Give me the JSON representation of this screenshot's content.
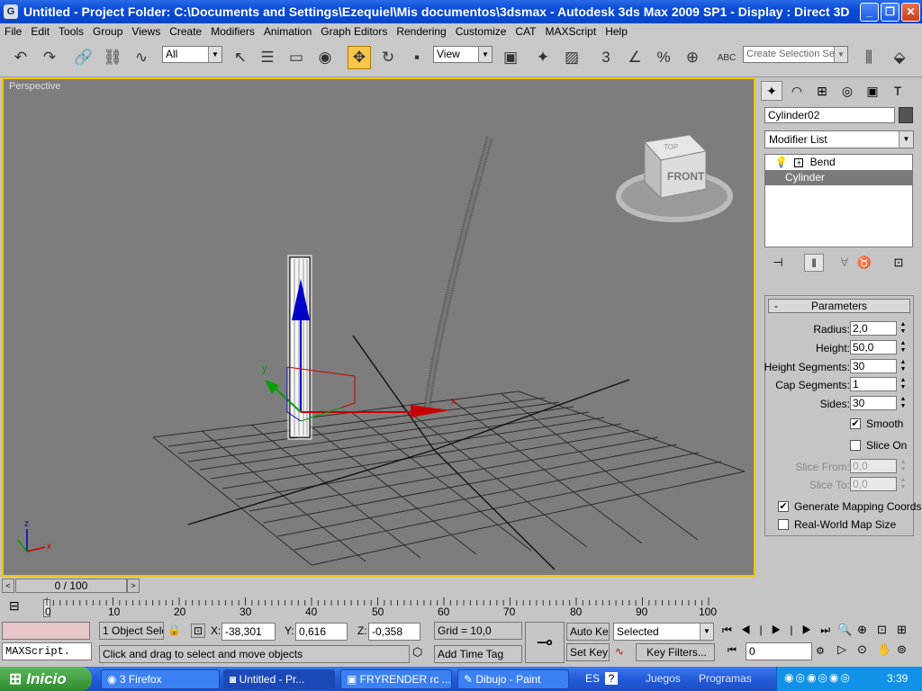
{
  "window": {
    "app_glyph": "G",
    "title": "Untitled    - Project Folder: C:\\Documents and Settings\\Ezequiel\\Mis documentos\\3dsmax    - Autodesk 3ds Max  2009 SP1    - Display : Direct 3D",
    "min": "_",
    "max": "❐",
    "close": "✕"
  },
  "menu": [
    "File",
    "Edit",
    "Tools",
    "Group",
    "Views",
    "Create",
    "Modifiers",
    "Animation",
    "Graph Editors",
    "Rendering",
    "Customize",
    "CAT",
    "MAXScript",
    "Help"
  ],
  "toolbar": {
    "filter_value": "All",
    "refcoord_value": "View",
    "named_selection_placeholder": "Create Selection Set",
    "icons": {
      "undo": "↶",
      "redo": "↷",
      "link": "🔗",
      "unlink": "⛓",
      "bind": "∿",
      "select": "↖",
      "select_by_name": "☰",
      "rect_select": "▭",
      "window_cross": "◉",
      "move": "✥",
      "rotate": "↻",
      "scale": "▪",
      "pivot": "▣",
      "manipulate": "✦",
      "keyboard": "▨",
      "snap3": "3",
      "angle_snap": "∠",
      "percent_snap": "%",
      "spinner_snap": "⊕",
      "edit_named": "ABC",
      "mirror": "⫼",
      "align": "⬙"
    }
  },
  "viewport": {
    "label": "Perspective",
    "viewcube_front": "FRONT",
    "viewcube_top": "TOP",
    "gizmo_x": "x",
    "gizmo_y": "y",
    "axis_x": "x",
    "axis_z": "z"
  },
  "command_panel": {
    "tab_icons": [
      "✦",
      "◠",
      "⊞",
      "◎",
      "▣",
      "T"
    ],
    "object_name": "Cylinder02",
    "modifier_list": "Modifier List",
    "stack": [
      {
        "label": "Bend",
        "prefix": "+",
        "selected": false
      },
      {
        "label": "Cylinder",
        "selected": true
      }
    ],
    "stack_tools": [
      "⊣",
      "‖",
      "∀",
      "♉",
      "⊡"
    ],
    "rollout_toggle": "-",
    "rollout_title": "Parameters",
    "params": [
      {
        "label": "Radius:",
        "value": "2,0",
        "disabled": false
      },
      {
        "label": "Height:",
        "value": "50,0",
        "disabled": false
      },
      {
        "label": "Height Segments:",
        "value": "30",
        "disabled": false
      },
      {
        "label": "Cap Segments:",
        "value": "1",
        "disabled": false
      },
      {
        "label": "Sides:",
        "value": "30",
        "disabled": false
      }
    ],
    "smooth": {
      "label": "Smooth",
      "checked": true
    },
    "slice_on": {
      "label": "Slice On",
      "checked": false
    },
    "slice_params": [
      {
        "label": "Slice From:",
        "value": "0,0",
        "disabled": true
      },
      {
        "label": "Slice To:",
        "value": "0,0",
        "disabled": true
      }
    ],
    "gen_mapping": {
      "label": "Generate Mapping Coords.",
      "checked": true
    },
    "real_world": {
      "label": "Real-World Map Size",
      "checked": false
    },
    "check_mark": "✔"
  },
  "timeslider": {
    "value": "0 / 100",
    "prev": "<",
    "next": ">"
  },
  "trackbar": {
    "ticks": [
      0,
      10,
      20,
      30,
      40,
      50,
      60,
      70,
      80,
      90,
      100
    ],
    "labels": [
      "0",
      "10",
      "20",
      "30",
      "40",
      "50",
      "60",
      "70",
      "80",
      "90",
      "100"
    ]
  },
  "status": {
    "selection": "1 Object Sele",
    "lock": "🔒",
    "absmode": "⊡",
    "x_label": "X:",
    "x_value": "-38,301",
    "y_label": "Y:",
    "y_value": "0,616",
    "z_label": "Z:",
    "z_value": "-0,358",
    "grid": "Grid = 10,0",
    "key_icon": "⊸",
    "auto_key": "Auto Key",
    "set_key": "Set Key",
    "key_mode": "Selected",
    "key_filters": "Key Filters...",
    "frame": "0",
    "prompt": "Click and drag to select and move objects",
    "add_time_tag": "Add Time Tag",
    "maxscript": "MAXScript.",
    "playback": [
      "⏮",
      "◀|",
      "▶",
      "|▶",
      "⏭"
    ],
    "nav_icons": [
      "🔍",
      "⊕",
      "⊡",
      "⊞",
      "▷",
      "⊙",
      "✋",
      "⊚"
    ]
  },
  "taskbar": {
    "start": "Inicio",
    "items": [
      {
        "label": "3 Firefox",
        "active": false
      },
      {
        "label": "Untitled    - Pr...",
        "active": true
      },
      {
        "label": "FRYRENDER rc ...",
        "active": false
      },
      {
        "label": "Dibujo - Paint",
        "active": false
      }
    ],
    "lang": "ES",
    "help": "?",
    "quick1": "Juegos",
    "quick2": "Programas",
    "clock": "3:39"
  },
  "colors": {
    "viewport_border": "#f5c400",
    "viewport_bg": "#7d7d7d",
    "active_tool": "#f7c64b",
    "title_blue": "#0a4bd8"
  }
}
